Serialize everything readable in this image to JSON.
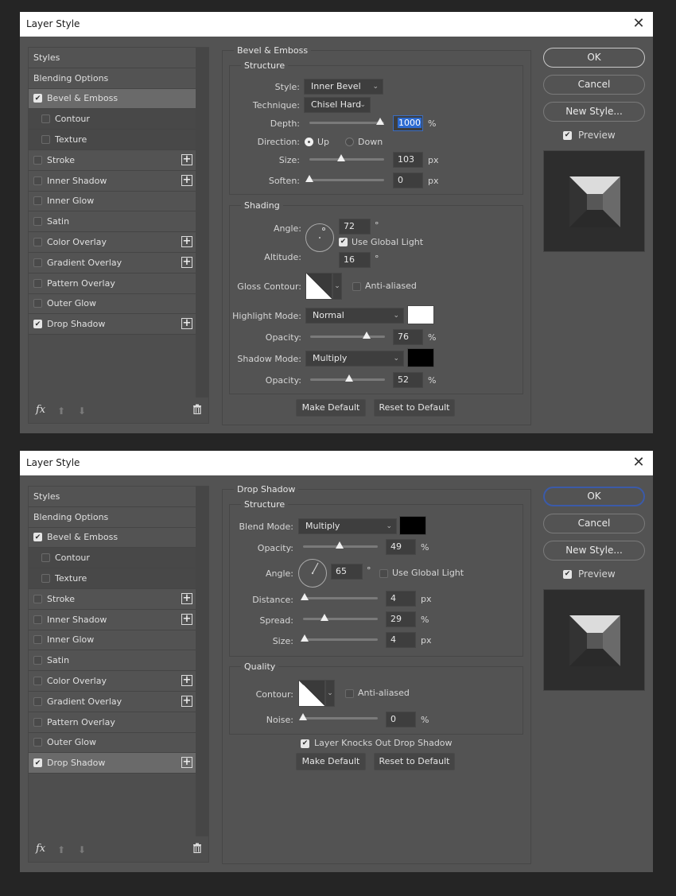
{
  "dialogs": [
    {
      "title": "Layer Style",
      "left": {
        "items": [
          {
            "label": "Styles",
            "checkbox": null,
            "plus": false,
            "sub": false,
            "active": false
          },
          {
            "label": "Blending Options",
            "checkbox": null,
            "plus": false,
            "sub": false,
            "active": false
          },
          {
            "label": "Bevel & Emboss",
            "checkbox": true,
            "plus": false,
            "sub": false,
            "active": true
          },
          {
            "label": "Contour",
            "checkbox": false,
            "plus": false,
            "sub": true,
            "active": false
          },
          {
            "label": "Texture",
            "checkbox": false,
            "plus": false,
            "sub": true,
            "active": false
          },
          {
            "label": "Stroke",
            "checkbox": false,
            "plus": true,
            "sub": false,
            "active": false
          },
          {
            "label": "Inner Shadow",
            "checkbox": false,
            "plus": true,
            "sub": false,
            "active": false
          },
          {
            "label": "Inner Glow",
            "checkbox": false,
            "plus": false,
            "sub": false,
            "active": false
          },
          {
            "label": "Satin",
            "checkbox": false,
            "plus": false,
            "sub": false,
            "active": false
          },
          {
            "label": "Color Overlay",
            "checkbox": false,
            "plus": true,
            "sub": false,
            "active": false
          },
          {
            "label": "Gradient Overlay",
            "checkbox": false,
            "plus": true,
            "sub": false,
            "active": false
          },
          {
            "label": "Pattern Overlay",
            "checkbox": false,
            "plus": false,
            "sub": false,
            "active": false
          },
          {
            "label": "Outer Glow",
            "checkbox": false,
            "plus": false,
            "sub": false,
            "active": false
          },
          {
            "label": "Drop Shadow",
            "checkbox": true,
            "plus": true,
            "sub": false,
            "active": false
          }
        ],
        "fx_label": "fx"
      },
      "panel": {
        "title": "Bevel & Emboss",
        "structure_title": "Structure",
        "style_label": "Style:",
        "style_value": "Inner Bevel",
        "technique_label": "Technique:",
        "technique_value": "Chisel Hard",
        "depth_label": "Depth:",
        "depth_value": "1000",
        "depth_unit": "%",
        "depth_slider": 0.95,
        "direction_label": "Direction:",
        "direction_up": "Up",
        "direction_down": "Down",
        "direction_selected": "Up",
        "size_label": "Size:",
        "size_value": "103",
        "size_unit": "px",
        "size_slider": 0.43,
        "soften_label": "Soften:",
        "soften_value": "0",
        "soften_unit": "px",
        "soften_slider": 0.0,
        "shading_title": "Shading",
        "angle_label": "Angle:",
        "angle_value": "72",
        "angle_unit": "°",
        "use_global_light_label": "Use Global Light",
        "use_global_light": true,
        "altitude_label": "Altitude:",
        "altitude_value": "16",
        "altitude_unit": "°",
        "gloss_contour_label": "Gloss Contour:",
        "anti_aliased_label": "Anti-aliased",
        "anti_aliased": false,
        "highlight_mode_label": "Highlight Mode:",
        "highlight_mode_value": "Normal",
        "highlight_color": "#ffffff",
        "highlight_opacity_label": "Opacity:",
        "highlight_opacity_value": "76",
        "highlight_opacity_unit": "%",
        "highlight_opacity_slider": 0.76,
        "shadow_mode_label": "Shadow Mode:",
        "shadow_mode_value": "Multiply",
        "shadow_color": "#000000",
        "shadow_opacity_label": "Opacity:",
        "shadow_opacity_value": "52",
        "shadow_opacity_unit": "%",
        "shadow_opacity_slider": 0.52,
        "make_default": "Make Default",
        "reset_default": "Reset to Default"
      },
      "right": {
        "ok": "OK",
        "cancel": "Cancel",
        "new_style": "New Style...",
        "preview_label": "Preview",
        "preview_checked": true
      }
    },
    {
      "title": "Layer Style",
      "left": {
        "items": [
          {
            "label": "Styles",
            "checkbox": null,
            "plus": false,
            "sub": false,
            "active": false
          },
          {
            "label": "Blending Options",
            "checkbox": null,
            "plus": false,
            "sub": false,
            "active": false
          },
          {
            "label": "Bevel & Emboss",
            "checkbox": true,
            "plus": false,
            "sub": false,
            "active": false
          },
          {
            "label": "Contour",
            "checkbox": false,
            "plus": false,
            "sub": true,
            "active": false
          },
          {
            "label": "Texture",
            "checkbox": false,
            "plus": false,
            "sub": true,
            "active": false
          },
          {
            "label": "Stroke",
            "checkbox": false,
            "plus": true,
            "sub": false,
            "active": false
          },
          {
            "label": "Inner Shadow",
            "checkbox": false,
            "plus": true,
            "sub": false,
            "active": false
          },
          {
            "label": "Inner Glow",
            "checkbox": false,
            "plus": false,
            "sub": false,
            "active": false
          },
          {
            "label": "Satin",
            "checkbox": false,
            "plus": false,
            "sub": false,
            "active": false
          },
          {
            "label": "Color Overlay",
            "checkbox": false,
            "plus": true,
            "sub": false,
            "active": false
          },
          {
            "label": "Gradient Overlay",
            "checkbox": false,
            "plus": true,
            "sub": false,
            "active": false
          },
          {
            "label": "Pattern Overlay",
            "checkbox": false,
            "plus": false,
            "sub": false,
            "active": false
          },
          {
            "label": "Outer Glow",
            "checkbox": false,
            "plus": false,
            "sub": false,
            "active": false
          },
          {
            "label": "Drop Shadow",
            "checkbox": true,
            "plus": true,
            "sub": false,
            "active": true
          }
        ],
        "fx_label": "fx"
      },
      "panel": {
        "title": "Drop Shadow",
        "structure_title": "Structure",
        "blend_mode_label": "Blend Mode:",
        "blend_mode_value": "Multiply",
        "blend_color": "#000000",
        "opacity_label": "Opacity:",
        "opacity_value": "49",
        "opacity_unit": "%",
        "opacity_slider": 0.49,
        "angle_label": "Angle:",
        "angle_value": "65",
        "angle_unit": "°",
        "use_global_light_label": "Use Global Light",
        "use_global_light": false,
        "distance_label": "Distance:",
        "distance_value": "4",
        "distance_unit": "px",
        "distance_slider": 0.02,
        "spread_label": "Spread:",
        "spread_value": "29",
        "spread_unit": "%",
        "spread_slider": 0.29,
        "size_label": "Size:",
        "size_value": "4",
        "size_unit": "px",
        "size_slider": 0.02,
        "quality_title": "Quality",
        "contour_label": "Contour:",
        "anti_aliased_label": "Anti-aliased",
        "anti_aliased": false,
        "noise_label": "Noise:",
        "noise_value": "0",
        "noise_unit": "%",
        "noise_slider": 0.0,
        "knockout_label": "Layer Knocks Out Drop Shadow",
        "knockout": true,
        "make_default": "Make Default",
        "reset_default": "Reset to Default"
      },
      "right": {
        "ok": "OK",
        "cancel": "Cancel",
        "new_style": "New Style...",
        "preview_label": "Preview",
        "preview_checked": true
      }
    }
  ],
  "icons": {
    "close": "✕",
    "check": "✔",
    "plus": "+",
    "chevron": "⌄",
    "up": "⬆",
    "down": "⬇",
    "trash": "🗑"
  }
}
